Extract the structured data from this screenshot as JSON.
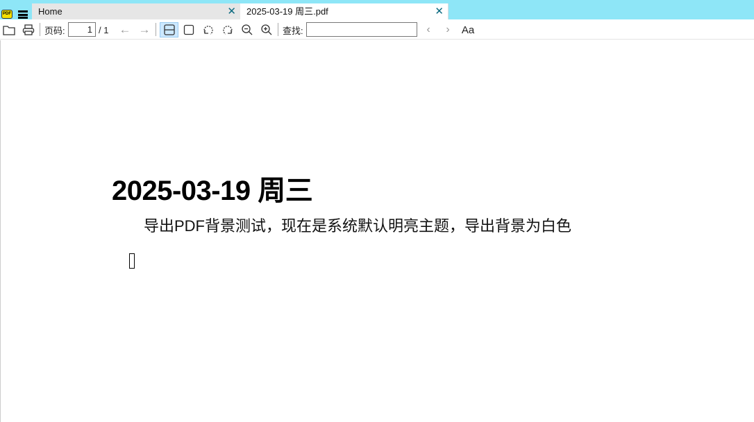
{
  "app": {
    "logo_text": "PDF"
  },
  "tabs": [
    {
      "label": "Home",
      "active": false
    },
    {
      "label": "2025-03-19 周三.pdf",
      "active": true
    }
  ],
  "toolbar": {
    "page_label": "页码:",
    "page_value": "1",
    "page_total": "/ 1",
    "find_label": "查找:",
    "find_value": "",
    "font_toggle": "Aa"
  },
  "document": {
    "heading": "2025-03-19 周三",
    "paragraph": "导出PDF背景测试，现在是系统默认明亮主题，导出背景为白色"
  },
  "colors": {
    "titlebar": "#8ee6f7",
    "tab_close": "#0b6a80",
    "active_view": "#cce8ff"
  }
}
